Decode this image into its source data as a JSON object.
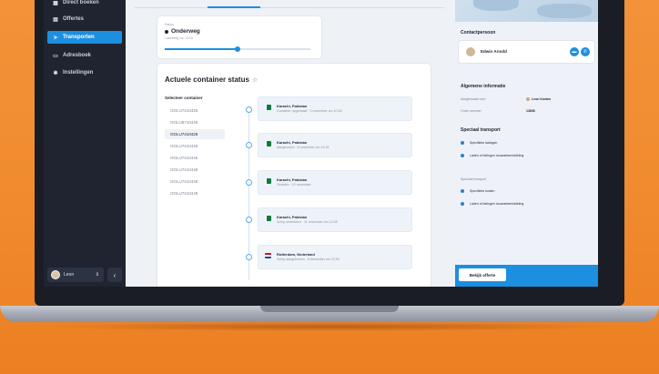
{
  "sidebar": {
    "items": [
      {
        "label": "Direct boeken",
        "icon": "calendar-icon"
      },
      {
        "label": "Offertes",
        "icon": "document-icon"
      },
      {
        "label": "Transporten",
        "icon": "plane-icon"
      },
      {
        "label": "Adresboek",
        "icon": "card-icon"
      },
      {
        "label": "Instellingen",
        "icon": "gear-icon"
      }
    ],
    "user": {
      "name": "Leon"
    }
  },
  "status": {
    "small_label": "Status",
    "value": "Onderweg",
    "sub": "Laadbelfg om 13:00",
    "progress": 0.5
  },
  "containers": {
    "title": "Actuele container status",
    "select_label": "Selecteer container",
    "items": [
      "OOLU7410426",
      "OOLU8710449",
      "OOLU7410426",
      "OOLU7410449",
      "OOLU7410446",
      "OOLU7410449",
      "OOLU7410449",
      "OOLU7410449"
    ],
    "selected_index": 2
  },
  "events": [
    {
      "title": "Karachi, Pakistan",
      "desc": "Container opgehaald · 3 november om 10:18",
      "flag": "pk"
    },
    {
      "title": "Karachi, Pakistan",
      "desc": "Aangevoerd · 8 november om 14:35",
      "flag": "pk"
    },
    {
      "title": "Karachi, Pakistan",
      "desc": "Geladen · 10 november",
      "flag": "pk"
    },
    {
      "title": "Karachi, Pakistan",
      "desc": "Schip vertrokken · 11 november om 12:08",
      "flag": "pk"
    },
    {
      "title": "Rotterdam, Nederland",
      "desc": "Schip aangekomen · 8 december om 12:53",
      "flag": "nl"
    }
  ],
  "right": {
    "contact_title": "Contactpersoon",
    "contact_name": "Edwin Arnold",
    "info_title": "Algemene informatie",
    "info": [
      {
        "label": "Aangemaakt door",
        "value": "Leon Kosten"
      },
      {
        "label": "Order nummer",
        "value": "13806"
      }
    ],
    "special_title": "Speciaal transport",
    "special_items": [
      "Specifieke ladingen",
      "Laden of belingen douanebemiddeling"
    ],
    "special_muted": "Speciaal transport",
    "special_items2": [
      "Specifieke kosten",
      "Laden of belingen douanebemiddeling"
    ],
    "button_label": "Bekijk offerte"
  }
}
